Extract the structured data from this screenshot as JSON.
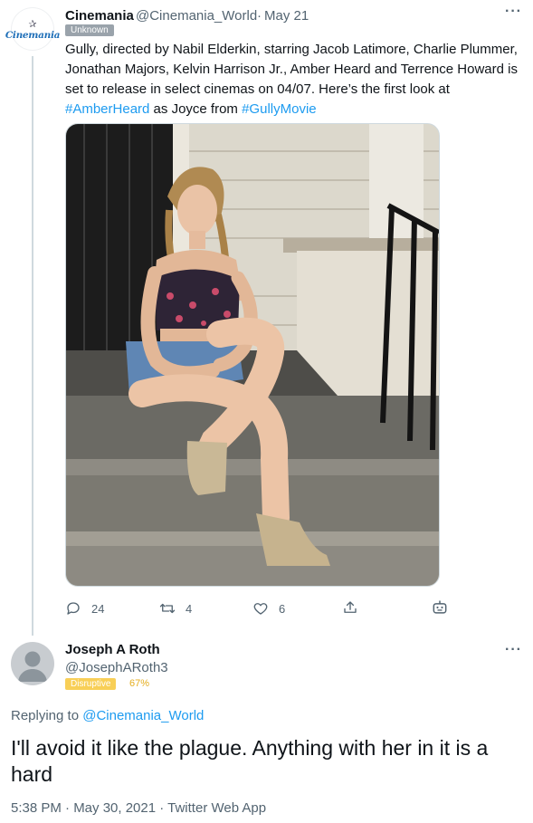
{
  "tweet": {
    "avatar_text": "Cinemania",
    "display_name": "Cinemania",
    "handle": "@Cinemania_World",
    "separator": "·",
    "date": "May 21",
    "badge": "Unknown",
    "text_part1": "Gully, directed by Nabil Elderkin, starring Jacob Latimore, Charlie Plummer, Jonathan Majors, Kelvin Harrison Jr., Amber Heard and Terrence Howard is set to release in select cinemas on 04/07. Here’s the first look at ",
    "hashtag1": "#AmberHeard",
    "text_part2": " as Joyce from ",
    "hashtag2": "#GullyMovie",
    "more": "···"
  },
  "actions": {
    "reply_count": "24",
    "retweet_count": "4",
    "like_count": "6",
    "icons": [
      "reply-icon",
      "retweet-icon",
      "like-icon",
      "share-icon",
      "bot-icon"
    ]
  },
  "reply": {
    "display_name": "Joseph A Roth",
    "handle": "@JosephARoth3",
    "badge": "Disruptive",
    "badge_pct": "67%",
    "more": "···",
    "replying_prefix": "Replying to ",
    "replying_to": "@Cinemania_World",
    "text": "I'll avoid it like the plague. Anything with her in it is a hard",
    "meta": "5:38 PM · May 30, 2021 · Twitter Web App"
  },
  "colors": {
    "link": "#1d9bf0",
    "secondary_text": "#536471",
    "badge_unknown": "#9aa3ab",
    "badge_disruptive": "#f8cf57"
  }
}
